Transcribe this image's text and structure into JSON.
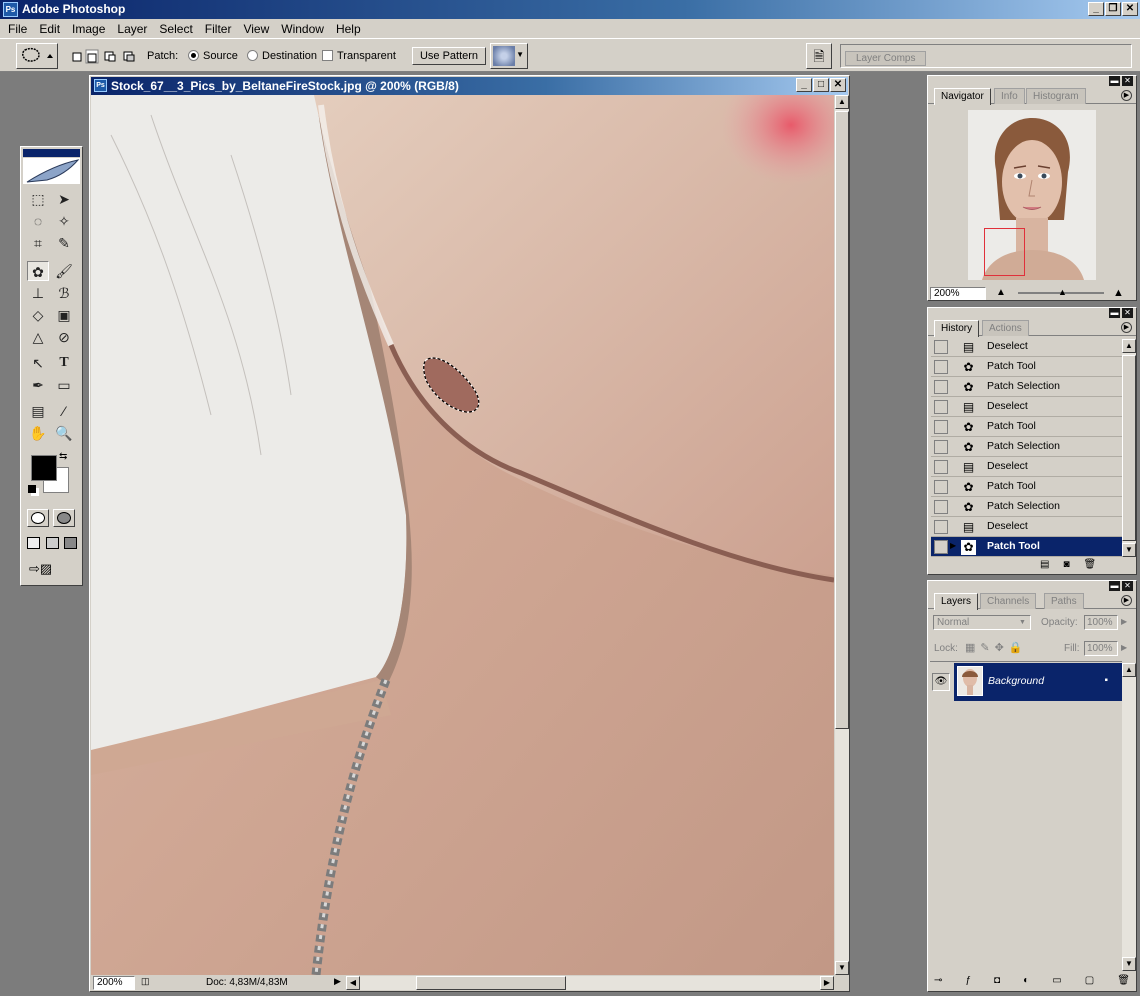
{
  "app": {
    "title": "Adobe Photoshop"
  },
  "menu": [
    "File",
    "Edit",
    "Image",
    "Layer",
    "Select",
    "Filter",
    "View",
    "Window",
    "Help"
  ],
  "options": {
    "patch_label": "Patch:",
    "source_label": "Source",
    "destination_label": "Destination",
    "transparent_label": "Transparent",
    "use_pattern_label": "Use Pattern",
    "layer_comps_label": "Layer Comps",
    "patch_mode": "Source"
  },
  "document": {
    "title": "Stock_67__3_Pics_by_BeltaneFireStock.jpg @ 200% (RGB/8)",
    "zoom": "200%",
    "doc_info": "Doc: 4,83M/4,83M"
  },
  "navigator": {
    "tabs": [
      "Navigator",
      "Info",
      "Histogram"
    ],
    "zoom": "200%"
  },
  "history": {
    "tabs": [
      "History",
      "Actions"
    ],
    "items": [
      {
        "label": "Deselect",
        "icon": "deselect-icon"
      },
      {
        "label": "Patch Tool",
        "icon": "patch-tool-icon"
      },
      {
        "label": "Patch Selection",
        "icon": "patch-tool-icon"
      },
      {
        "label": "Deselect",
        "icon": "deselect-icon"
      },
      {
        "label": "Patch Tool",
        "icon": "patch-tool-icon"
      },
      {
        "label": "Patch Selection",
        "icon": "patch-tool-icon"
      },
      {
        "label": "Deselect",
        "icon": "deselect-icon"
      },
      {
        "label": "Patch Tool",
        "icon": "patch-tool-icon"
      },
      {
        "label": "Patch Selection",
        "icon": "patch-tool-icon"
      },
      {
        "label": "Deselect",
        "icon": "deselect-icon"
      },
      {
        "label": "Patch Tool",
        "icon": "patch-tool-icon"
      }
    ],
    "current": "Patch Tool"
  },
  "layers": {
    "tabs": [
      "Layers",
      "Channels",
      "Paths"
    ],
    "blend_mode": "Normal",
    "opacity_label": "Opacity:",
    "opacity": "100%",
    "lock_label": "Lock:",
    "fill_label": "Fill:",
    "fill": "100%",
    "items": [
      {
        "name": "Background"
      }
    ]
  },
  "colors": {
    "selection": "#0a246a",
    "chrome": "#d4d0c8",
    "nav_box": "#e0303a"
  }
}
